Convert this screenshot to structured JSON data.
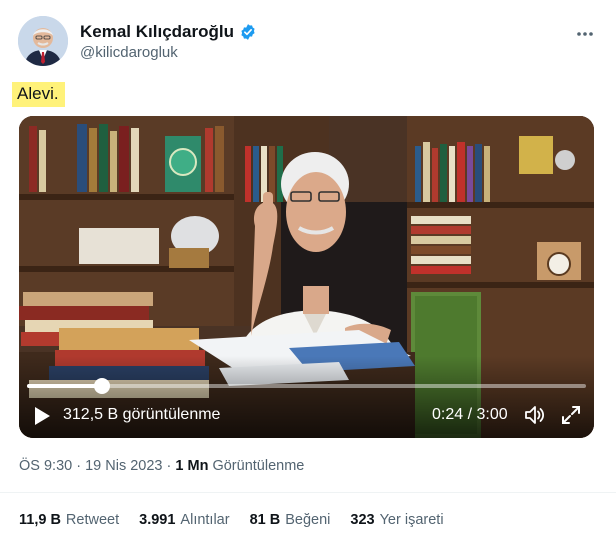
{
  "author": {
    "display_name": "Kemal Kılıçdaroğlu",
    "handle": "@kilicdarogluk",
    "verified": true
  },
  "tweet": {
    "text": "Alevi.",
    "highlight_color": "#fff27a"
  },
  "video": {
    "views_label": "312,5 B görüntülenme",
    "time_label": "0:24 / 3:00",
    "progress": 0.1333
  },
  "meta": {
    "time": "ÖS 9:30",
    "separator": "·",
    "date": "19 Nis 2023",
    "views_count": "1 Mn",
    "views_label": "Görüntülenme"
  },
  "stats": {
    "retweets": {
      "count": "11,9 B",
      "label": "Retweet"
    },
    "quotes": {
      "count": "3.991",
      "label": "Alıntılar"
    },
    "likes": {
      "count": "81 B",
      "label": "Beğeni"
    },
    "bookmarks": {
      "count": "323",
      "label": "Yer işareti"
    }
  },
  "icons": {
    "more": "more-icon",
    "verified": "verified-badge-icon",
    "play": "play-icon",
    "volume": "volume-icon",
    "fullscreen": "fullscreen-icon"
  },
  "colors": {
    "text_primary": "#0f1419",
    "text_secondary": "#536471",
    "verified_blue": "#1d9bf0"
  }
}
